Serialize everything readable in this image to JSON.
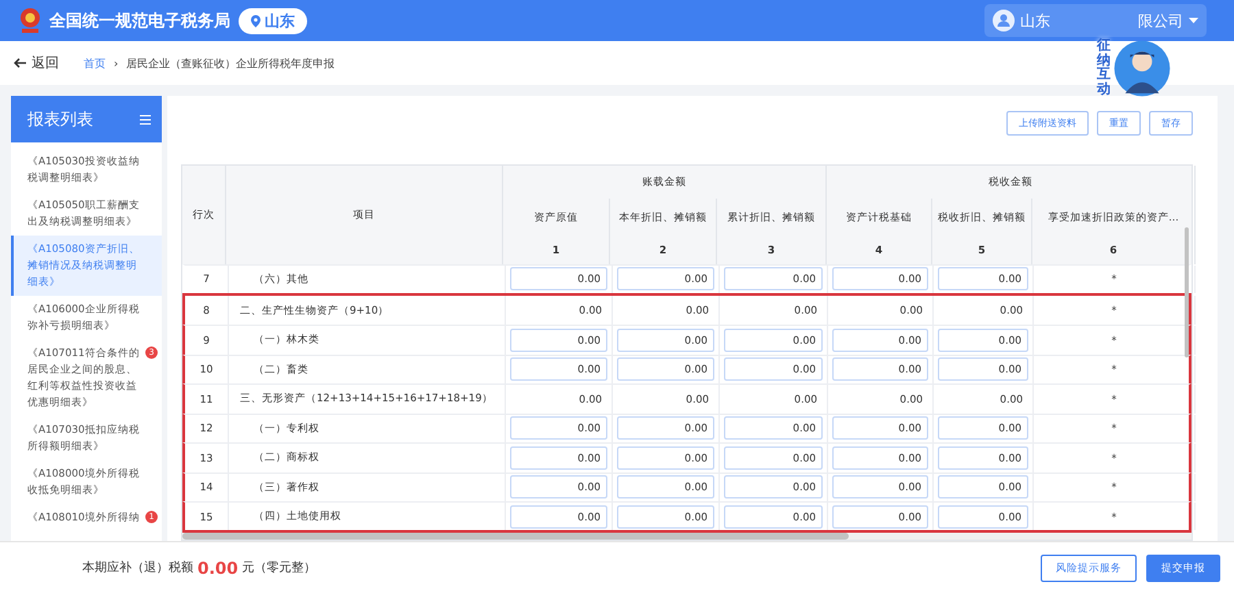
{
  "header": {
    "site_title": "全国统一规范电子税务局",
    "region": "山东",
    "user_name_parts": [
      "山东",
      "限公司"
    ],
    "assistant_label": "征纳互动"
  },
  "breadcrumb": {
    "back": "返回",
    "home": "首页",
    "separator": "›",
    "current": "居民企业（查账征收）企业所得税年度申报"
  },
  "sidebar": {
    "title": "报表列表",
    "items": [
      {
        "label": "《A105030投资收益纳税调整明细表》",
        "selected": false
      },
      {
        "label": "《A105050职工薪酬支出及纳税调整明细表》",
        "selected": false
      },
      {
        "label": "《A105080资产折旧、摊销情况及纳税调整明细表》",
        "selected": true
      },
      {
        "label": "《A106000企业所得税弥补亏损明细表》",
        "selected": false
      },
      {
        "label": "《A107011符合条件的居民企业之间的股息、红利等权益性投资收益优惠明细表》",
        "selected": false,
        "badge": "3"
      },
      {
        "label": "《A107030抵扣应纳税所得额明细表》",
        "selected": false
      },
      {
        "label": "《A108000境外所得税收抵免明细表》",
        "selected": false
      },
      {
        "label": "《A108010境外所得纳",
        "selected": false,
        "badge": "1"
      }
    ]
  },
  "toolbar": [
    "上传附送资料",
    "重置",
    "暂存"
  ],
  "table": {
    "row_no_header": "行次",
    "item_header": "项目",
    "groups": [
      {
        "label": "账载金额",
        "columns": [
          {
            "name": "资产原值",
            "no": "1"
          },
          {
            "name": "本年折旧、摊销额",
            "no": "2"
          },
          {
            "name": "累计折旧、摊销额",
            "no": "3"
          }
        ]
      },
      {
        "label": "税收金额",
        "columns": [
          {
            "name": "资产计税基础",
            "no": "4"
          },
          {
            "name": "税收折旧、摊销额",
            "no": "5"
          },
          {
            "name": "享受加速折旧政策的资产...",
            "no": "6"
          }
        ]
      }
    ],
    "rows": [
      {
        "no": "7",
        "item": "（六）其他",
        "kind": "input",
        "highlighted": false,
        "values": [
          "0.00",
          "0.00",
          "0.00",
          "0.00",
          "0.00",
          "*"
        ]
      },
      {
        "no": "8",
        "item": "二、生产性生物资产（9+10）",
        "kind": "total",
        "highlighted": true,
        "values": [
          "0.00",
          "0.00",
          "0.00",
          "0.00",
          "0.00",
          "*"
        ]
      },
      {
        "no": "9",
        "item": "（一）林木类",
        "kind": "input",
        "highlighted": true,
        "values": [
          "0.00",
          "0.00",
          "0.00",
          "0.00",
          "0.00",
          "*"
        ]
      },
      {
        "no": "10",
        "item": "（二）畜类",
        "kind": "input",
        "highlighted": true,
        "values": [
          "0.00",
          "0.00",
          "0.00",
          "0.00",
          "0.00",
          "*"
        ]
      },
      {
        "no": "11",
        "item": "三、无形资产（12+13+14+15+16+17+18+19）",
        "kind": "total",
        "highlighted": true,
        "values": [
          "0.00",
          "0.00",
          "0.00",
          "0.00",
          "0.00",
          "*"
        ]
      },
      {
        "no": "12",
        "item": "（一）专利权",
        "kind": "input",
        "highlighted": true,
        "values": [
          "0.00",
          "0.00",
          "0.00",
          "0.00",
          "0.00",
          "*"
        ]
      },
      {
        "no": "13",
        "item": "（二）商标权",
        "kind": "input",
        "highlighted": true,
        "values": [
          "0.00",
          "0.00",
          "0.00",
          "0.00",
          "0.00",
          "*"
        ]
      },
      {
        "no": "14",
        "item": "（三）著作权",
        "kind": "input",
        "highlighted": true,
        "values": [
          "0.00",
          "0.00",
          "0.00",
          "0.00",
          "0.00",
          "*"
        ]
      },
      {
        "no": "15",
        "item": "（四）土地使用权",
        "kind": "input",
        "highlighted": true,
        "values": [
          "0.00",
          "0.00",
          "0.00",
          "0.00",
          "0.00",
          "*"
        ]
      }
    ]
  },
  "footer": {
    "label": "本期应补（退）税额",
    "amount": "0.00",
    "unit": "元（零元整）",
    "buttons": [
      {
        "label": "风险提示服务",
        "kind": "secondary"
      },
      {
        "label": "提交申报",
        "kind": "primary"
      }
    ]
  }
}
